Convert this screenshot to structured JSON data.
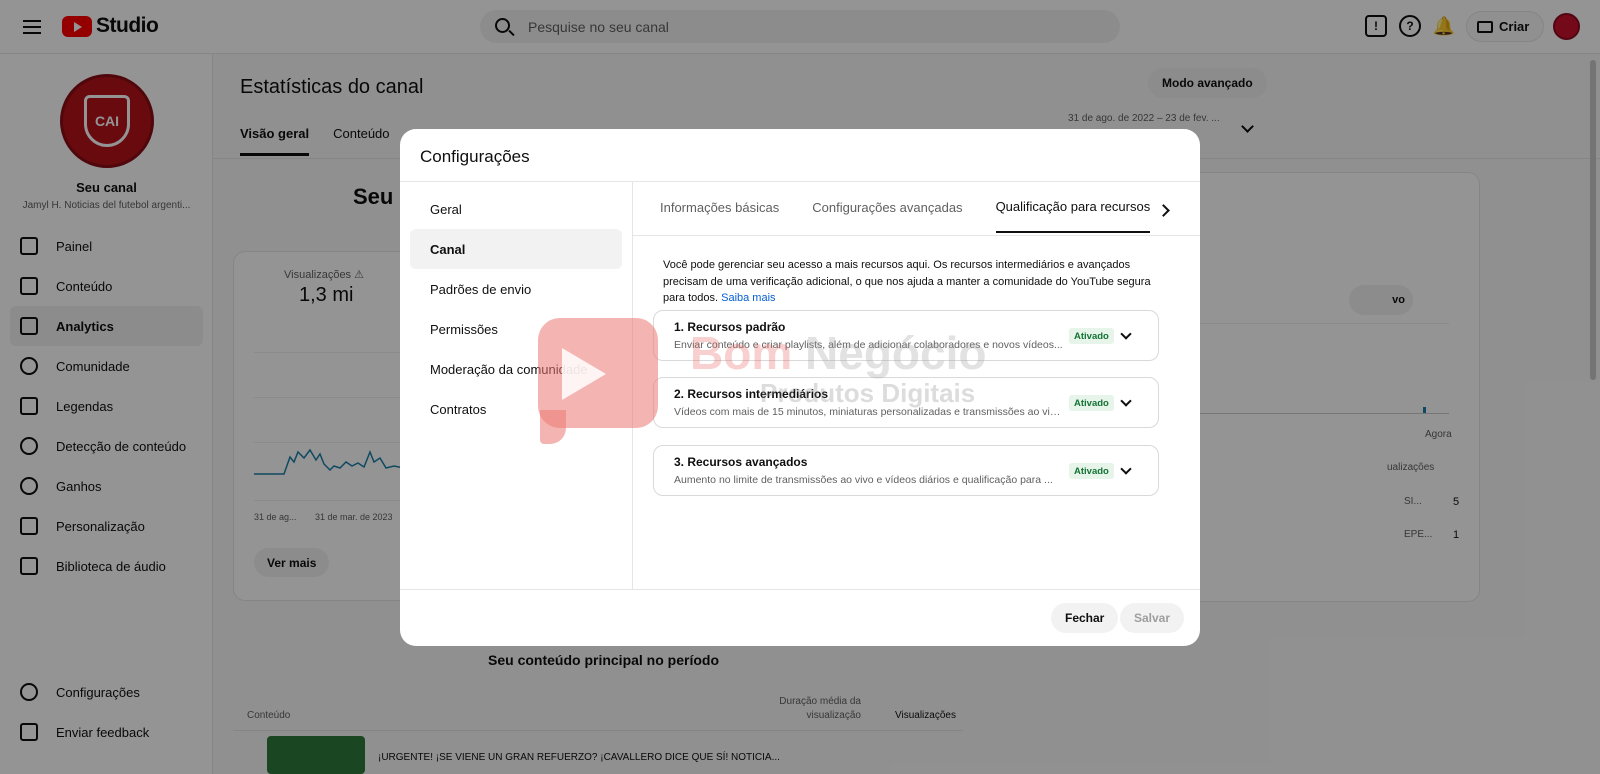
{
  "header": {
    "logo_text": "Studio",
    "search_placeholder": "Pesquise no seu canal",
    "create_label": "Criar"
  },
  "sidebar": {
    "channel_title": "Seu canal",
    "channel_name": "Jamyl H. Noticias del futebol argenti...",
    "items": [
      {
        "label": "Painel",
        "icon": "dashboard-icon"
      },
      {
        "label": "Conteúdo",
        "icon": "content-icon"
      },
      {
        "label": "Analytics",
        "icon": "analytics-icon",
        "active": true
      },
      {
        "label": "Comunidade",
        "icon": "community-icon"
      },
      {
        "label": "Legendas",
        "icon": "subtitles-icon"
      },
      {
        "label": "Detecção de conteúdo",
        "icon": "copyright-icon"
      },
      {
        "label": "Ganhos",
        "icon": "earn-icon"
      },
      {
        "label": "Personalização",
        "icon": "customization-icon"
      },
      {
        "label": "Biblioteca de áudio",
        "icon": "audio-library-icon"
      }
    ],
    "bottom_items": [
      {
        "label": "Configurações",
        "icon": "gear-icon"
      },
      {
        "label": "Enviar feedback",
        "icon": "feedback-icon"
      }
    ]
  },
  "main": {
    "page_title": "Estatísticas do canal",
    "mode_button": "Modo avançado",
    "date_range": "31 de ago. de 2022 – 23 de fev. ...",
    "tabs": [
      "Visão geral",
      "Conteúdo"
    ],
    "heading_partial": "Seu c",
    "views_label": "Visualizações",
    "views_value": "1,3 mi",
    "x_labels": [
      "31 de ag...",
      "31 de mar. de 2023"
    ],
    "see_more": "Ver mais",
    "right_chip": "vo",
    "right_now": "Agora",
    "right_views": "ualizações",
    "right_row1_text": "SI...",
    "right_row1_value": "5",
    "right_row2_text": "EPE...",
    "right_row2_value": "1",
    "top_content_title": "Seu conteúdo principal no período",
    "table_head_content": "Conteúdo",
    "table_head_duration": "Duração média da visualização",
    "table_head_views": "Visualizações",
    "table_row_title": "¡URGENTE! ¡SE VIENE UN GRAN REFUERZO? ¡CAVALLERO DICE QUE SÍ! NOTICIA..."
  },
  "modal": {
    "title": "Configurações",
    "nav": [
      "Geral",
      "Canal",
      "Padrões de envio",
      "Permissões",
      "Moderação da comunidade",
      "Contratos"
    ],
    "active_nav_index": 1,
    "tabs": [
      "Informações básicas",
      "Configurações avançadas",
      "Qualificação para recursos"
    ],
    "active_tab_index": 2,
    "intro": "Você pode gerenciar seu acesso a mais recursos aqui. Os recursos intermediários e avançados precisam de uma verificação adicional, o que nos ajuda a manter a comunidade do YouTube segura para todos.",
    "learn_more": "Saiba mais",
    "features": [
      {
        "title": "1. Recursos padrão",
        "desc": "Enviar conteúdo e criar playlists, além de adicionar colaboradores e novos vídeos...",
        "status": "Ativado"
      },
      {
        "title": "2. Recursos intermediários",
        "desc": "Vídeos com mais de 15 minutos, miniaturas personalizadas e transmissões ao vivo...",
        "status": "Ativado"
      },
      {
        "title": "3. Recursos avançados",
        "desc": "Aumento no limite de transmissões ao vivo e vídeos diários e qualificação para ...",
        "status": "Ativado"
      }
    ],
    "close_button": "Fechar",
    "save_button": "Salvar"
  },
  "watermark": {
    "line1_a": "Bom",
    "line1_b": "Negócio",
    "line2": "Produtos Digitais"
  }
}
